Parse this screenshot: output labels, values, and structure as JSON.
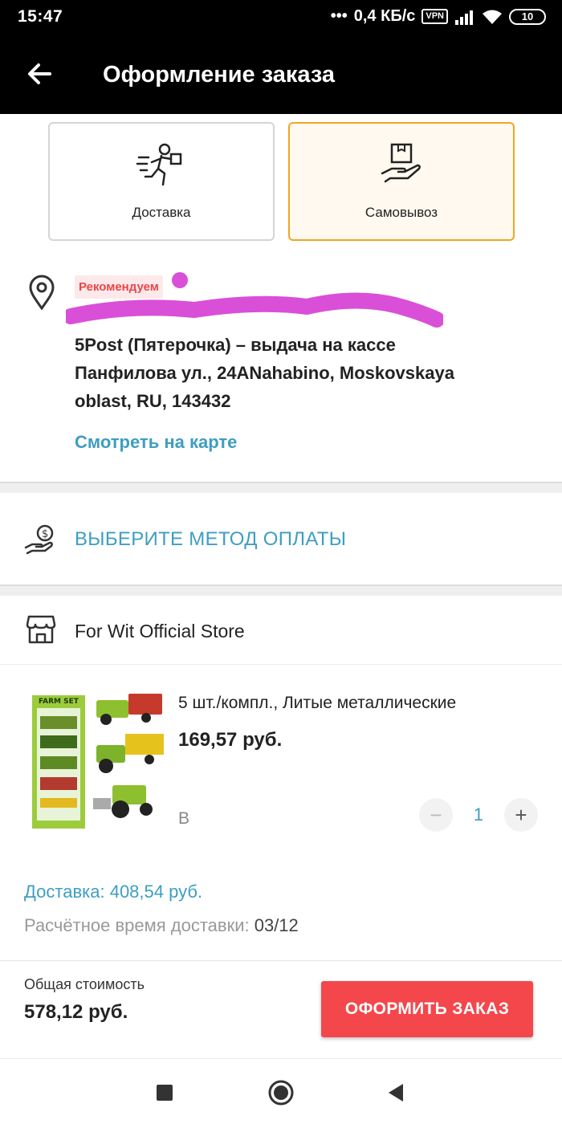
{
  "status_bar": {
    "time": "15:47",
    "network_speed": "0,4 КБ/с",
    "vpn": "VPN",
    "battery": "10"
  },
  "header": {
    "title": "Оформление заказа",
    "back_icon": "arrow-left-icon"
  },
  "delivery_options": [
    {
      "label": "Доставка",
      "icon": "courier-icon",
      "selected": false
    },
    {
      "label": "Самовывоз",
      "icon": "pickup-box-hand-icon",
      "selected": true
    }
  ],
  "address": {
    "badge": "Рекомендуем",
    "line1": "5Post (Пятерочка) – выдача на кассе",
    "line2": "Панфилова ул., 24ANahabino, Moskovskaya",
    "line3": "oblast, RU, 143432",
    "map_link": "Смотреть на карте"
  },
  "payment": {
    "label": "ВЫБЕРИТЕ МЕТОД ОПЛАТЫ",
    "icon": "hand-coin-icon"
  },
  "store": {
    "name": "For Wit Official Store",
    "icon": "store-icon"
  },
  "product": {
    "title": "5 шт./компл., Литые металлические",
    "price": "169,57 руб.",
    "variant": "B",
    "quantity": "1",
    "minus": "−",
    "plus": "+",
    "image_text": "FARM SET"
  },
  "shipping": {
    "cost": "Доставка: 408,54 руб.",
    "time_label": "Расчётное время доставки: ",
    "time_value": "03/12"
  },
  "footer": {
    "total_label": "Общая стоимость",
    "total_value": "578,12 руб.",
    "checkout": "ОФОРМИТЬ ЗАКАЗ"
  },
  "colors": {
    "accent_blue": "#3e9ec1",
    "checkout_red": "#f4474c",
    "selected_border": "#f2a523",
    "redaction": "#d94fd8"
  }
}
